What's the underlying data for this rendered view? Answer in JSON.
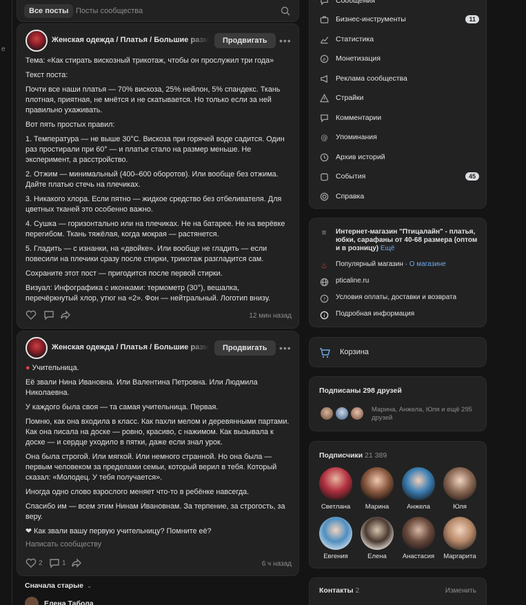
{
  "tabs": {
    "all_posts": "Все посты",
    "community_posts": "Посты сообщества"
  },
  "post1": {
    "group_name": "Женская одежда / Платья / Большие размеры",
    "promote_label": "Продвигать",
    "paragraphs": [
      "Тема: «Как стирать вискозный трикотаж, чтобы он прослужил три года»",
      "Текст поста:",
      "Почти все наши платья — 70% вискоза, 25% нейлон, 5% спандекс. Ткань плотная, приятная, не мнётся и не скатывается. Но только если за ней правильно ухаживать.",
      "Вот пять простых правил:",
      "1. Температура — не выше 30°C. Вискоза при горячей воде садится. Один раз простирали при 60° — и платье стало на размер меньше. Не эксперимент, а расстройство.",
      "2. Отжим — минимальный (400–600 оборотов). Или вообще без отжима. Дайте платью стечь на плечиках.",
      "3. Никакого хлора. Если пятно — жидкое средство без отбеливателя. Для цветных тканей это особенно важно.",
      "4. Сушка — горизонтально или на плечиках. Не на батарее. Не на верёвке перегибом. Ткань тяжёлая, когда мокрая — растянется.",
      "5. Гладить — с изнанки, на «двойке». Или вообще не гладить — если повесили на плечики сразу после стирки, трикотаж разгладится сам.",
      "Сохраните этот пост — пригодится после первой стирки.",
      "Визуал: Инфографика с иконками: термометр (30°), вешалка, перечёркнутый хлор, утюг на «2». Фон — нейтральный. Логотип внизу."
    ],
    "time": "12 мин назад"
  },
  "post2": {
    "group_name": "Женская одежда / Платья / Большие размеры",
    "promote_label": "Продвигать",
    "title": "Учительница.",
    "paragraphs": [
      "Её звали Нина Ивановна. Или Валентина Петровна. Или Людмила Николаевна.",
      "У каждого была своя — та самая учительница. Первая.",
      "Помню, как она входила в класс. Как пахли мелом и деревянными партами. Как она писала на доске — ровно, красиво, с нажимом. Как вызывала к доске — и сердце уходило в пятки, даже если знал урок.",
      "Она была строгой. Или мягкой. Или немного странной. Но она была — первым человеком за пределами семьи, который верил в тебя. Который сказал: «Молодец. У тебя получается».",
      "Иногда одно слово взрослого меняет что-то в ребёнке навсегда.",
      "Спасибо им — всем этим Нинам Ивановнам. За терпение, за строгость, за веру."
    ],
    "question": "Как звали вашу первую учительницу? Помните её?",
    "write_label": "Написать сообществу",
    "likes": "2",
    "comments": "1",
    "time": "6 ч назад"
  },
  "comments": {
    "sort_label": "Сначала старые",
    "first_author": "Елена Табола"
  },
  "menu": [
    {
      "icon": "message-icon",
      "label": "Сообщения",
      "badge": ""
    },
    {
      "icon": "briefcase-icon",
      "label": "Бизнес-инструменты",
      "badge": "11"
    },
    {
      "icon": "chart-icon",
      "label": "Статистика",
      "badge": ""
    },
    {
      "icon": "coin-icon",
      "label": "Монетизация",
      "badge": ""
    },
    {
      "icon": "megaphone-icon",
      "label": "Реклама сообщества",
      "badge": ""
    },
    {
      "icon": "warning-icon",
      "label": "Страйки",
      "badge": ""
    },
    {
      "icon": "comment-icon",
      "label": "Комментарии",
      "badge": ""
    },
    {
      "icon": "at-icon",
      "label": "Упоминания",
      "badge": ""
    },
    {
      "icon": "archive-icon",
      "label": "Архив историй",
      "badge": ""
    },
    {
      "icon": "calendar-icon",
      "label": "События",
      "badge": "45"
    },
    {
      "icon": "help-circle-icon",
      "label": "Справка",
      "badge": ""
    }
  ],
  "info": {
    "description": "Интернет-магазин \"Птицалайн\" - платья, юбки, сарафаны от 40-68 размера (оптом и в розницу)",
    "more": "Ещё",
    "popular": "Популярный магазин",
    "about": "О магазине",
    "site": "pticaline.ru",
    "terms": "Условия оплаты, доставки и возврата",
    "details": "Подробная информация"
  },
  "cart": {
    "label": "Корзина"
  },
  "friends": {
    "title": "Подписаны 298 друзей",
    "text": "Марина, Анжела, Юля и ещё 295 друзей"
  },
  "subscribers": {
    "title": "Подписчики",
    "count": "21 389",
    "people": [
      {
        "name": "Светлана"
      },
      {
        "name": "Марина"
      },
      {
        "name": "Анжела"
      },
      {
        "name": "Юля"
      },
      {
        "name": "Евгения"
      },
      {
        "name": "Елена"
      },
      {
        "name": "Анастасия"
      },
      {
        "name": "Маргарита"
      }
    ]
  },
  "contacts": {
    "title": "Контакты",
    "count": "2",
    "edit": "Изменить"
  },
  "colors": {
    "bg": "#141414",
    "card": "#222222",
    "link": "#71aaeb",
    "accent_red": "#e64646"
  }
}
